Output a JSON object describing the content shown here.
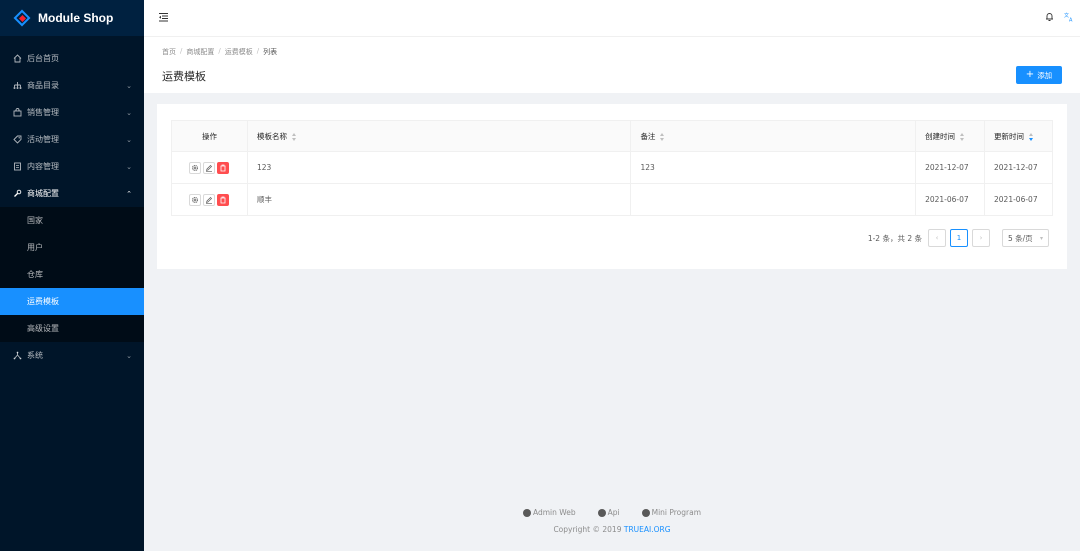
{
  "app": {
    "name": "Module Shop"
  },
  "colors": {
    "primary": "#1890ff",
    "sidebar_bg": "#001529",
    "danger": "#ff4d4f"
  },
  "sidebar": {
    "items": [
      {
        "label": "后台首页",
        "icon": "home-icon",
        "has_arrow": false
      },
      {
        "label": "商品目录",
        "icon": "cluster-icon",
        "has_arrow": true
      },
      {
        "label": "销售管理",
        "icon": "shopping-icon",
        "has_arrow": true
      },
      {
        "label": "活动管理",
        "icon": "tag-icon",
        "has_arrow": true
      },
      {
        "label": "内容管理",
        "icon": "file-icon",
        "has_arrow": true
      },
      {
        "label": "商城配置",
        "icon": "tool-icon",
        "has_arrow": true,
        "open": true
      },
      {
        "label": "系统",
        "icon": "setting-icon",
        "has_arrow": true
      }
    ],
    "submenu": [
      {
        "label": "国家",
        "active": false
      },
      {
        "label": "用户",
        "active": false
      },
      {
        "label": "仓库",
        "active": false
      },
      {
        "label": "运费模板",
        "active": true
      },
      {
        "label": "高级设置",
        "active": false
      }
    ]
  },
  "breadcrumb": [
    "首页",
    "商城配置",
    "运费模板",
    "列表"
  ],
  "page": {
    "title": "运费模板",
    "add_label": "添加"
  },
  "table": {
    "columns": [
      "操作",
      "模板名称",
      "备注",
      "创建时间",
      "更新时间"
    ],
    "sort": {
      "updated": "desc"
    },
    "rows": [
      {
        "name": "123",
        "note": "123",
        "created": "2021-12-07",
        "updated": "2021-12-07"
      },
      {
        "name": "顺丰",
        "note": "",
        "created": "2021-06-07",
        "updated": "2021-06-07"
      }
    ]
  },
  "pagination": {
    "total_text": "1-2 条，共 2 条",
    "current_page": "1",
    "page_size": "5 条/页"
  },
  "footer": {
    "links": [
      "Admin Web",
      "Api",
      "Mini Program"
    ],
    "copyright_prefix": "Copyright",
    "copyright_year": "2019",
    "copyright_org": "TRUEAI.ORG"
  }
}
